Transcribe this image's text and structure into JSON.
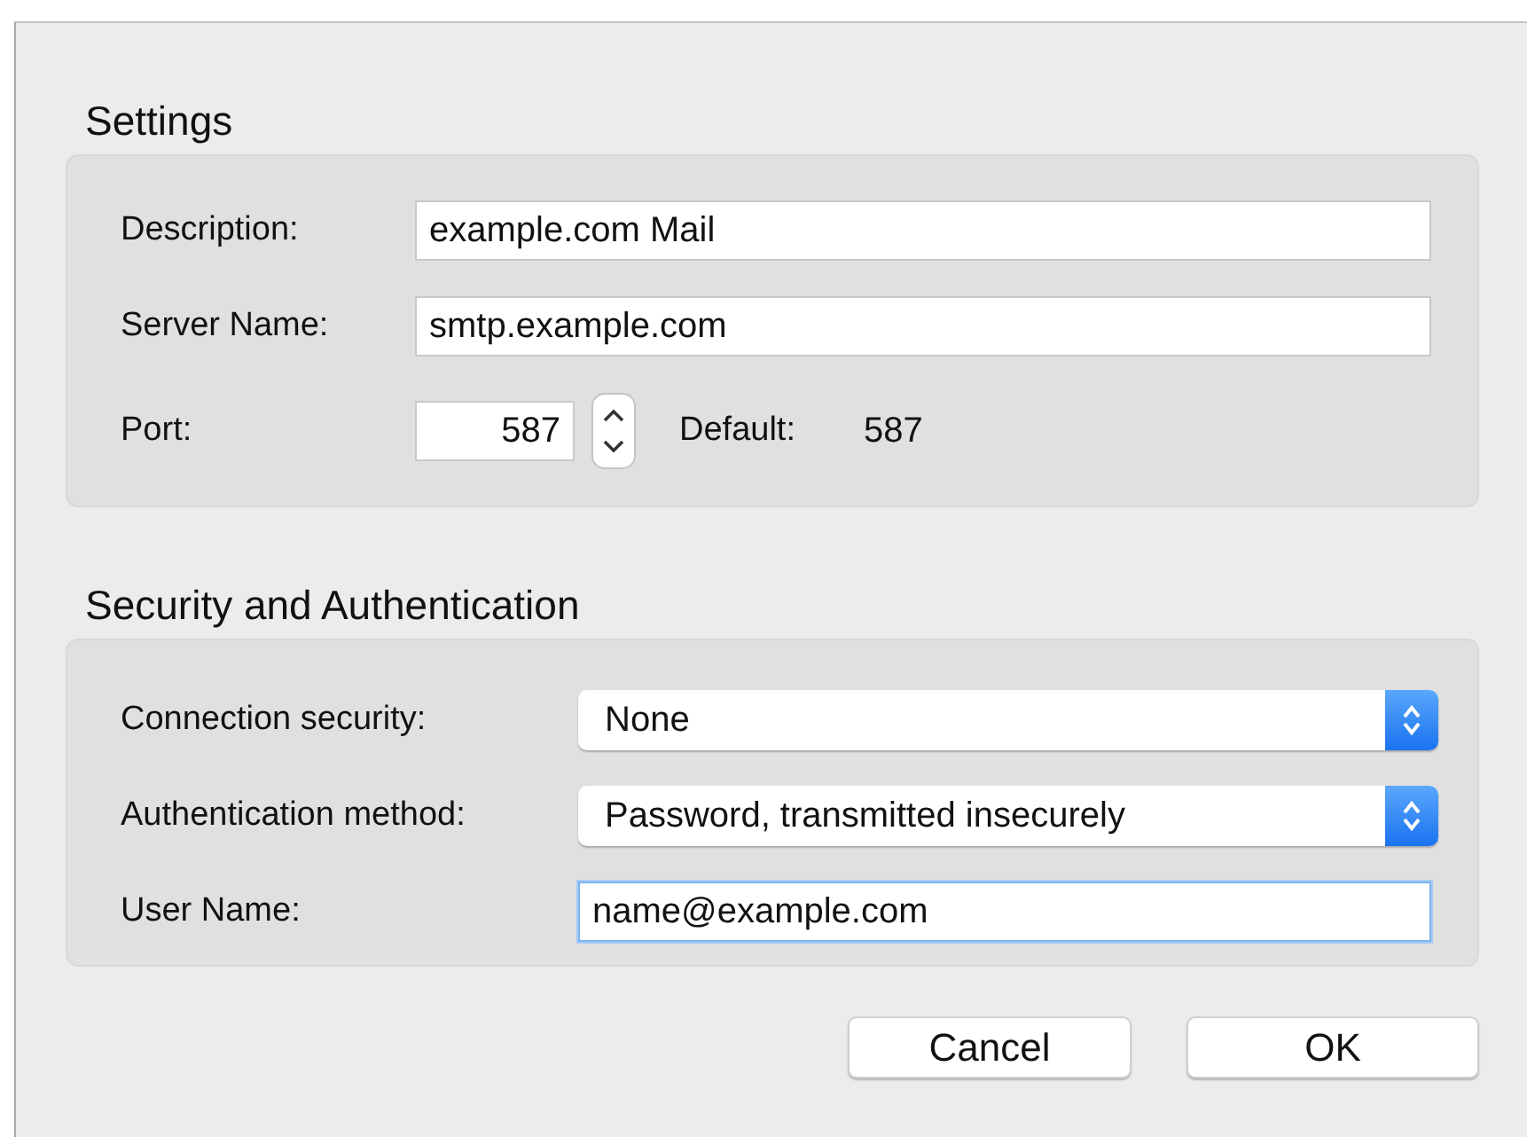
{
  "sections": [
    {
      "title": "Settings",
      "rows": [
        {
          "kind": "text",
          "label": "Description:",
          "value": "example.com Mail",
          "focused": false
        },
        {
          "kind": "text",
          "label": "Server Name:",
          "value": "smtp.example.com",
          "focused": false
        },
        {
          "kind": "number",
          "label": "Port:",
          "value": "587",
          "default_label": "Default:",
          "default_value": "587",
          "focused": false
        }
      ]
    },
    {
      "title": "Security and Authentication",
      "rows": [
        {
          "kind": "select",
          "label": "Connection security:",
          "value": "None",
          "focused": false
        },
        {
          "kind": "select",
          "label": "Authentication method:",
          "value": "Password, transmitted insecurely",
          "focused": false
        },
        {
          "kind": "text",
          "label": "User Name:",
          "value": "name@example.com",
          "focused": true
        }
      ]
    }
  ],
  "buttons": [
    "Cancel",
    "OK"
  ]
}
